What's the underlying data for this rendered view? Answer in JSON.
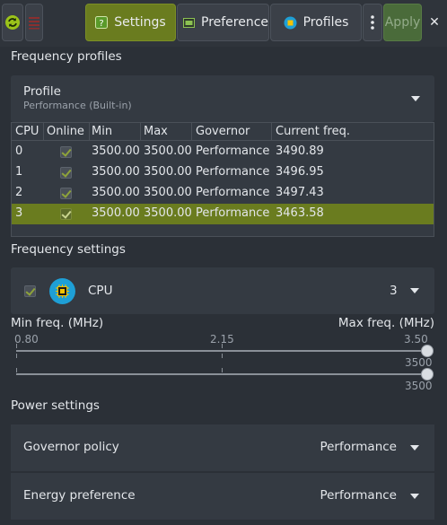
{
  "toolbar": {
    "settings_label": "Settings",
    "preferences_label": "Preferences",
    "profiles_label": "Profiles",
    "apply_label": "Apply",
    "close_glyph": "✕"
  },
  "frequency_profiles": {
    "title": "Frequency profiles",
    "profile_label": "Profile",
    "profile_value": "Performance (Built-in)"
  },
  "cpu_table": {
    "columns": [
      "CPU",
      "Online",
      "Min",
      "Max",
      "Governor",
      "Current freq."
    ],
    "rows": [
      {
        "cpu": "0",
        "online": true,
        "min": "3500.00",
        "max": "3500.00",
        "governor": "Performance",
        "current": "3490.89"
      },
      {
        "cpu": "1",
        "online": true,
        "min": "3500.00",
        "max": "3500.00",
        "governor": "Performance",
        "current": "3496.95"
      },
      {
        "cpu": "2",
        "online": true,
        "min": "3500.00",
        "max": "3500.00",
        "governor": "Performance",
        "current": "3497.43"
      },
      {
        "cpu": "3",
        "online": true,
        "min": "3500.00",
        "max": "3500.00",
        "governor": "Performance",
        "current": "3463.58"
      }
    ],
    "selected_row": 3
  },
  "frequency_settings": {
    "title": "Frequency settings",
    "cpu_label": "CPU",
    "cpu_value": "3",
    "min_label": "Min freq. (MHz)",
    "max_label": "Max freq. (MHz)",
    "scale_min": "0.80",
    "scale_mid": "2.15",
    "scale_max": "3.50",
    "min_value": "3500",
    "max_value": "3500"
  },
  "power_settings": {
    "title": "Power settings",
    "governor_label": "Governor policy",
    "governor_value": "Performance",
    "energy_label": "Energy preference",
    "energy_value": "Performance"
  },
  "colors": {
    "accent": "#6a7c1f",
    "background": "#2b3037",
    "card": "#343a42",
    "cpu_icon": "#1e9fd6"
  }
}
